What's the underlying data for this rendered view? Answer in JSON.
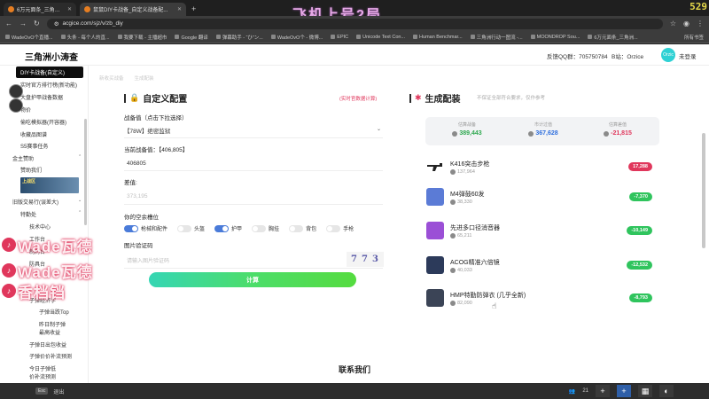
{
  "browser": {
    "tabs": [
      {
        "label": "6万元面条_三角洲小涛查_三角..."
      },
      {
        "label": "鼠鼠DIY卡战备_自定义战备配..."
      }
    ],
    "url": "acgice.com/sjz/v/zb_diy",
    "stream_title": "飞机上号2局",
    "fps": "529",
    "bookmarks": [
      "WadeOvO个直播...",
      "头条 - 每个人的直...",
      "我要下载 - 主播超市",
      "Google 翻译",
      "弹幕助手 - “ひ”ン...",
      "WadeOvO个 - 微博...",
      "EPIC",
      "Unicode Text Con...",
      "Human Benchmar...",
      "三角洲行动一图流 -...",
      "MOONDROP Sou...",
      "6万元面条_三角洲..."
    ],
    "bookmarks_right": "所有书签"
  },
  "header": {
    "logo": "三角洲小涛查",
    "qq": "反馈QQ群：705750784",
    "bilibili": "B站：Orzice",
    "avatar_text": "Orzic",
    "login": "未登录"
  },
  "sidebar": {
    "items": [
      {
        "label": "DIY卡战备(自定义)",
        "active": true
      },
      {
        "label": "实时官方排行榜(新功能)"
      },
      {
        "label": "大盘护甲战备数据"
      },
      {
        "label": "物价"
      },
      {
        "label": "偷吃模拟器(开容器)"
      },
      {
        "label": "收藏品图谱"
      },
      {
        "label": "S5赛事任务"
      },
      {
        "label": "金主赞助"
      },
      {
        "label": "赞助我们"
      },
      {
        "label": "旧版交易行(误差大)"
      },
      {
        "label": "特勤处"
      },
      {
        "label": "技术中心"
      },
      {
        "label": "工作台"
      },
      {
        "label": "制药台"
      },
      {
        "label": "防具台"
      },
      {
        "label": "子弹经济学"
      },
      {
        "label": "子弹当跌Top"
      },
      {
        "label": "昨日制子弹"
      },
      {
        "label": "最高收益"
      },
      {
        "label": "子弹日出包收益"
      },
      {
        "label": "子弹价价补流预测"
      },
      {
        "label": "今日子弹低"
      },
      {
        "label": "价补流预测"
      }
    ],
    "banner_text": "上战区"
  },
  "watermarks": [
    "Wade瓦德",
    "Wade瓦德",
    "香档铛"
  ],
  "config": {
    "faded_tabs": [
      "新收买战备",
      "生成配装"
    ],
    "title": "自定义配置",
    "note": "(实时官数据计算)",
    "budget_label": "战备值（点击下拉选择）",
    "budget_selected": "【78W】绝密监狱",
    "current_label": "当前战备值：【406,805】",
    "current_value": "406805",
    "diff_label": "差值:",
    "diff_value": "373,195",
    "slots_label": "你的空余槽位",
    "slots": [
      {
        "label": "枪械和配件",
        "on": true
      },
      {
        "label": "头盔",
        "on": false
      },
      {
        "label": "护甲",
        "on": true
      },
      {
        "label": "胸挂",
        "on": false
      },
      {
        "label": "背包",
        "on": false
      },
      {
        "label": "手枪",
        "on": false
      }
    ],
    "captcha_label": "图片验证码",
    "captcha_placeholder": "请输入图片验证码",
    "captcha_chars": [
      "7",
      "7",
      "3"
    ],
    "calc_button": "计算"
  },
  "result": {
    "title": "生成配装",
    "note": "不保证全部符合要求，仅作参考",
    "stats": [
      {
        "label": "估算战备",
        "value": "389,443",
        "tone": "pos"
      },
      {
        "label": "市计过值",
        "value": "367,628",
        "tone": "blue"
      },
      {
        "label": "估算差值",
        "value": "-21,815",
        "tone": "neg"
      }
    ],
    "items": [
      {
        "name": "K416突击步枪",
        "price": "137,964",
        "badge": "17,288",
        "badge_color": "red",
        "thumb_color": "#222222"
      },
      {
        "name": "M4弹鼓60发",
        "price": "38,330",
        "badge": "-7,370",
        "badge_color": "green",
        "thumb_color": "#5b7bd6"
      },
      {
        "name": "先进多口径消音器",
        "price": "65,211",
        "badge": "-10,149",
        "badge_color": "green",
        "thumb_color": "#9b4fd6"
      },
      {
        "name": "ACOG精准六倍镜",
        "price": "40,033",
        "badge": "-12,532",
        "badge_color": "green",
        "thumb_color": "#2c3a5a"
      },
      {
        "name": "HMP特勤防弹衣 (几乎全新)",
        "price": "82,090",
        "badge": "-8,793",
        "badge_color": "green",
        "thumb_color": "#3b4456"
      }
    ]
  },
  "footer": {
    "contact": "联系我们"
  },
  "taskbar": {
    "esc": "Esc",
    "back": "退出",
    "count": "21"
  }
}
